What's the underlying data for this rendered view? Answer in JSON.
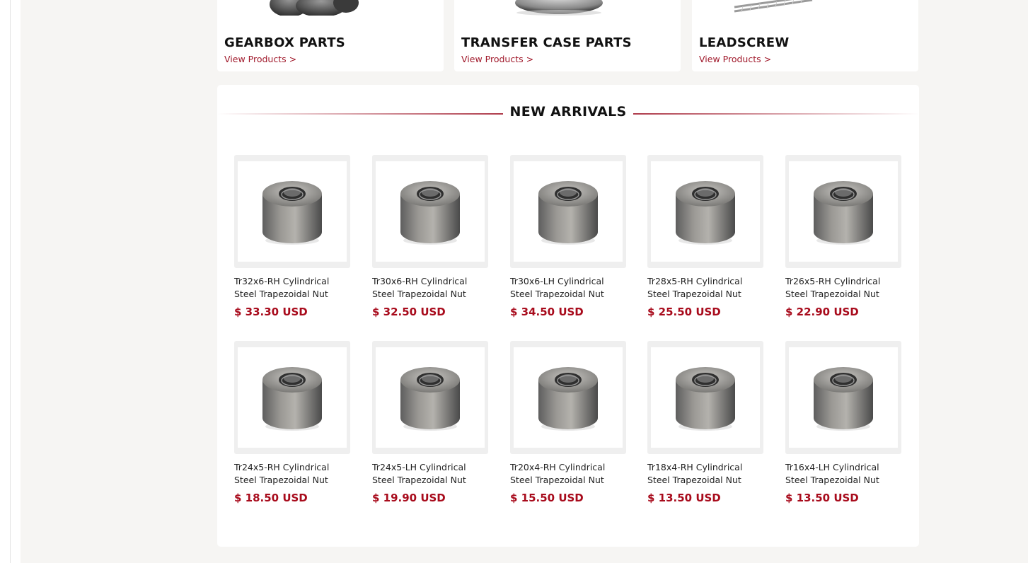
{
  "categories": [
    {
      "title": "GEARBOX PARTS",
      "link": "View Products >",
      "image": "gearbox-parts-image"
    },
    {
      "title": "TRANSFER CASE PARTS",
      "link": "View Products >",
      "image": "transfer-case-image"
    },
    {
      "title": "LEADSCREW",
      "link": "View Products >",
      "image": "leadscrew-image"
    }
  ],
  "arrivals": {
    "title": "NEW ARRIVALS",
    "products": [
      {
        "name_line1": "Tr32x6-RH Cylindrical",
        "name_line2": "Steel Trapezoidal Nut",
        "price": "$ 33.30 USD"
      },
      {
        "name_line1": "Tr30x6-RH Cylindrical",
        "name_line2": "Steel Trapezoidal Nut",
        "price": "$ 32.50 USD"
      },
      {
        "name_line1": "Tr30x6-LH Cylindrical",
        "name_line2": "Steel Trapezoidal Nut",
        "price": "$ 34.50 USD"
      },
      {
        "name_line1": "Tr28x5-RH Cylindrical",
        "name_line2": "Steel Trapezoidal Nut",
        "price": "$ 25.50 USD"
      },
      {
        "name_line1": "Tr26x5-RH Cylindrical",
        "name_line2": "Steel Trapezoidal Nut",
        "price": "$ 22.90 USD"
      },
      {
        "name_line1": "Tr24x5-RH Cylindrical",
        "name_line2": "Steel Trapezoidal Nut",
        "price": "$ 18.50 USD"
      },
      {
        "name_line1": "Tr24x5-LH Cylindrical",
        "name_line2": "Steel Trapezoidal Nut",
        "price": "$ 19.90 USD"
      },
      {
        "name_line1": "Tr20x4-RH Cylindrical",
        "name_line2": "Steel Trapezoidal Nut",
        "price": "$ 15.50 USD"
      },
      {
        "name_line1": "Tr18x4-RH Cylindrical",
        "name_line2": "Steel Trapezoidal Nut",
        "price": "$ 13.50 USD"
      },
      {
        "name_line1": "Tr16x4-LH Cylindrical",
        "name_line2": "Steel Trapezoidal Nut",
        "price": "$ 13.50 USD"
      }
    ]
  },
  "colors": {
    "accent": "#a80b1c",
    "page_background": "#f6f5f3",
    "card_background": "#ffffff"
  }
}
